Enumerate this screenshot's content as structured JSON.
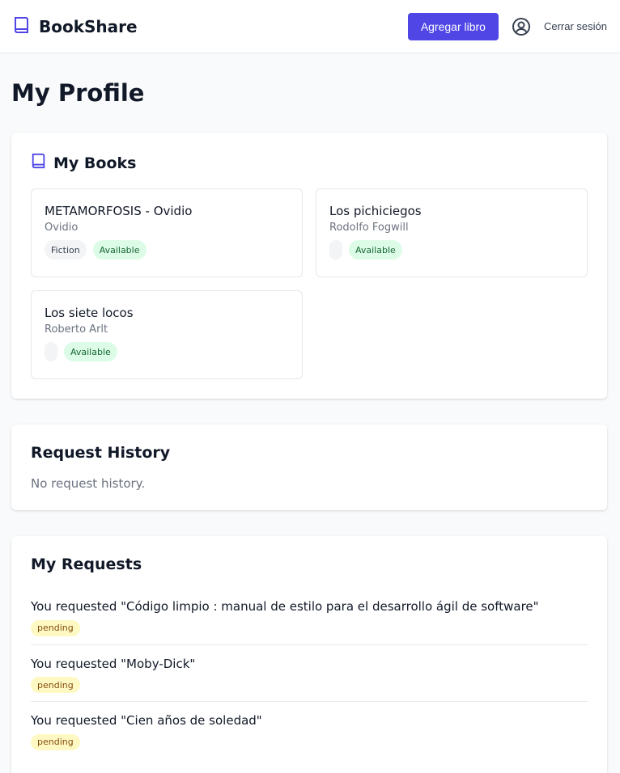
{
  "app": {
    "brand": "BookShare"
  },
  "nav": {
    "add_book": "Agregar libro",
    "logout": "Cerrar sesión"
  },
  "page": {
    "title": "My Profile"
  },
  "my_books": {
    "title": "My Books",
    "books": [
      {
        "title": "METAMORFOSIS - Ovidio",
        "author": "Ovidio",
        "genre": "Fiction",
        "status": "Available"
      },
      {
        "title": "Los pichiciegos",
        "author": "Rodolfo Fogwill",
        "genre": "",
        "status": "Available"
      },
      {
        "title": "Los siete locos",
        "author": "Roberto Arlt",
        "genre": "",
        "status": "Available"
      }
    ]
  },
  "request_history": {
    "title": "Request History",
    "empty": "No request history."
  },
  "my_requests": {
    "title": "My Requests",
    "items": [
      {
        "text": "You requested \"Código limpio : manual de estilo para el desarrollo ágil de software\"",
        "status": "pending"
      },
      {
        "text": "You requested \"Moby-Dick\"",
        "status": "pending"
      },
      {
        "text": "You requested \"Cien años de soledad\"",
        "status": "pending"
      }
    ]
  },
  "colors": {
    "primary": "#4f46e5",
    "available_bg": "#dcfce7",
    "pending_bg": "#fef9c3"
  }
}
